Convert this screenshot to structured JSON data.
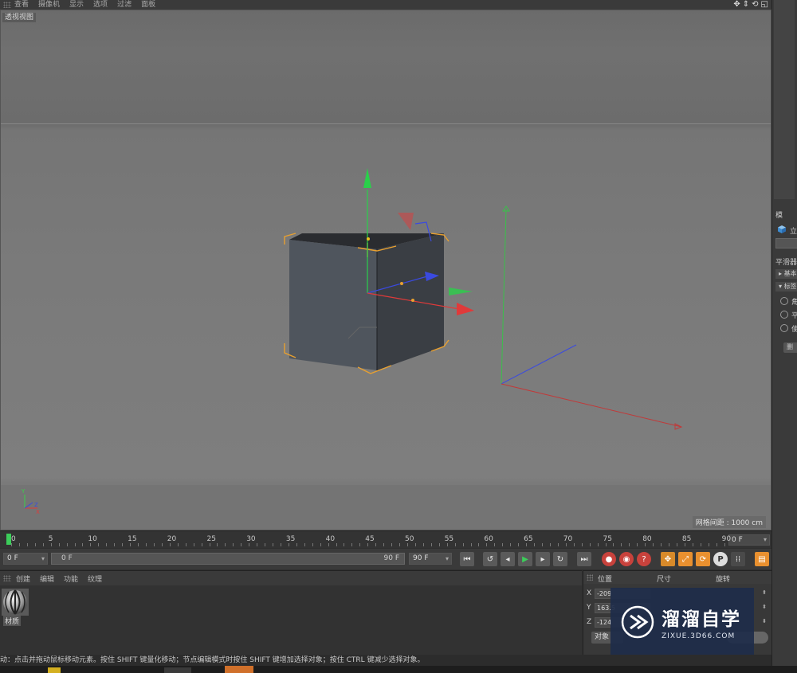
{
  "viewport_menu": [
    "查看",
    "摄像机",
    "显示",
    "选项",
    "过滤",
    "面板"
  ],
  "viewport_label": "透视视图",
  "grid_info": "网格间距 : 1000 cm",
  "timeline": {
    "ticks": [
      "0",
      "5",
      "10",
      "15",
      "20",
      "25",
      "30",
      "35",
      "40",
      "45",
      "50",
      "55",
      "60",
      "65",
      "70",
      "75",
      "80",
      "85",
      "90"
    ],
    "current_frame": "0 F"
  },
  "transport": {
    "start_frame": "0 F",
    "range_start": "0 F",
    "range_end": "90 F",
    "end_frame": "90 F"
  },
  "material_menu": [
    "创建",
    "编辑",
    "功能",
    "纹理"
  ],
  "material": {
    "label": "材质"
  },
  "coordinates": {
    "headers": [
      "位置",
      "尺寸",
      "旋转"
    ],
    "rows": [
      {
        "axis": "X",
        "value": "-209"
      },
      {
        "axis": "Y",
        "value": "163.5"
      },
      {
        "axis": "Z",
        "value": "-124"
      }
    ],
    "object_button": "对象"
  },
  "attributes": {
    "mode": "模",
    "object": "立",
    "section": "平滑器",
    "tab_basic": "基本",
    "tab_tag": "标签",
    "options": [
      "角",
      "平",
      "使"
    ],
    "button": "删"
  },
  "status_text": "动：点击并拖动鼠标移动元素。按住 SHIFT 键量化移动；节点编辑模式时按住 SHIFT 键增加选择对象；按住 CTRL 键减少选择对象。",
  "watermark": {
    "brand": "溜溜自学",
    "url": "ZIXUE.3D66.COM"
  },
  "colors": {
    "playhead": "#3ccd5a",
    "x_axis": "#e03a3a",
    "y_axis": "#3ad04a",
    "z_axis": "#3a52e0",
    "selection": "#e8a030",
    "watermark_bg": "#1e2c4a"
  },
  "icons": [
    "move-icon",
    "scale-icon",
    "rotate-icon",
    "play-icon",
    "record-icon",
    "help-icon",
    "material-ball-icon",
    "film-icon"
  ]
}
